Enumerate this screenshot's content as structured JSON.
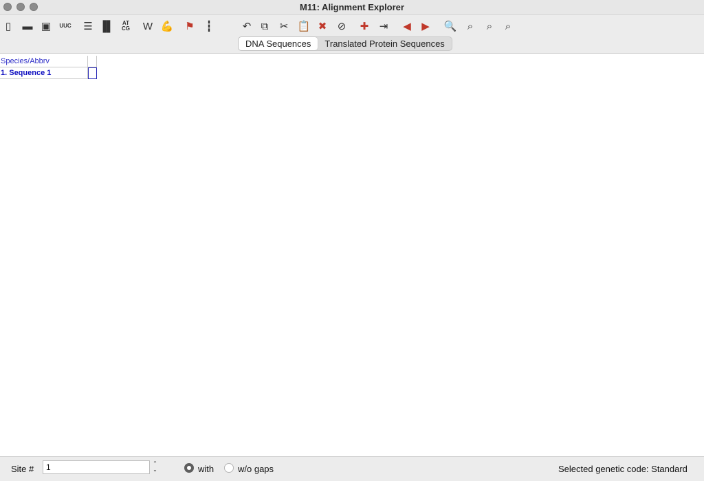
{
  "window": {
    "title": "M11: Alignment Explorer"
  },
  "toolbar": {
    "buttons": [
      {
        "name": "new-icon",
        "glyph": "▯"
      },
      {
        "name": "open-folder-icon",
        "glyph": "▬"
      },
      {
        "name": "save-icon",
        "glyph": "▣"
      },
      {
        "name": "uuc-icon",
        "glyph": "UUC"
      },
      {
        "name": "text-file-icon",
        "glyph": "☰"
      },
      {
        "name": "align-columns-icon",
        "glyph": "▐▌"
      },
      {
        "name": "atcg-icon",
        "glyph": "AT CG"
      },
      {
        "name": "w-icon",
        "glyph": "W"
      },
      {
        "name": "muscle-icon",
        "glyph": "💪"
      },
      {
        "name": "flag-icon",
        "glyph": "⚑"
      },
      {
        "name": "marker-icon",
        "glyph": "┇"
      },
      {
        "name": "undo-icon",
        "glyph": "↶"
      },
      {
        "name": "copy-icon",
        "glyph": "⧉"
      },
      {
        "name": "cut-icon",
        "glyph": "✂"
      },
      {
        "name": "paste-icon",
        "glyph": "📋"
      },
      {
        "name": "delete-icon",
        "glyph": "✖"
      },
      {
        "name": "delete-gap-icon",
        "glyph": "⊘"
      },
      {
        "name": "insert-icon",
        "glyph": "✚"
      },
      {
        "name": "add-sequence-icon",
        "glyph": "⇥"
      },
      {
        "name": "move-left-icon",
        "glyph": "◀"
      },
      {
        "name": "move-right-icon",
        "glyph": "▶"
      },
      {
        "name": "search-icon",
        "glyph": "🔍"
      },
      {
        "name": "search-prev-icon",
        "glyph": "⌕"
      },
      {
        "name": "search-next-icon",
        "glyph": "⌕"
      },
      {
        "name": "search-mark-icon",
        "glyph": "⌕"
      }
    ]
  },
  "tabs": [
    {
      "label": "DNA Sequences",
      "active": true
    },
    {
      "label": "Translated Protein Sequences",
      "active": false
    }
  ],
  "grid": {
    "header": "Species/Abbrv",
    "rows": [
      {
        "label": "1. Sequence 1"
      }
    ]
  },
  "status": {
    "site_label": "Site #",
    "site_value": "1",
    "stepper_up": "⌃",
    "stepper_down": "⌄",
    "with_label": "with",
    "without_label": "w/o gaps",
    "genetic_code": "Selected genetic code: Standard"
  }
}
